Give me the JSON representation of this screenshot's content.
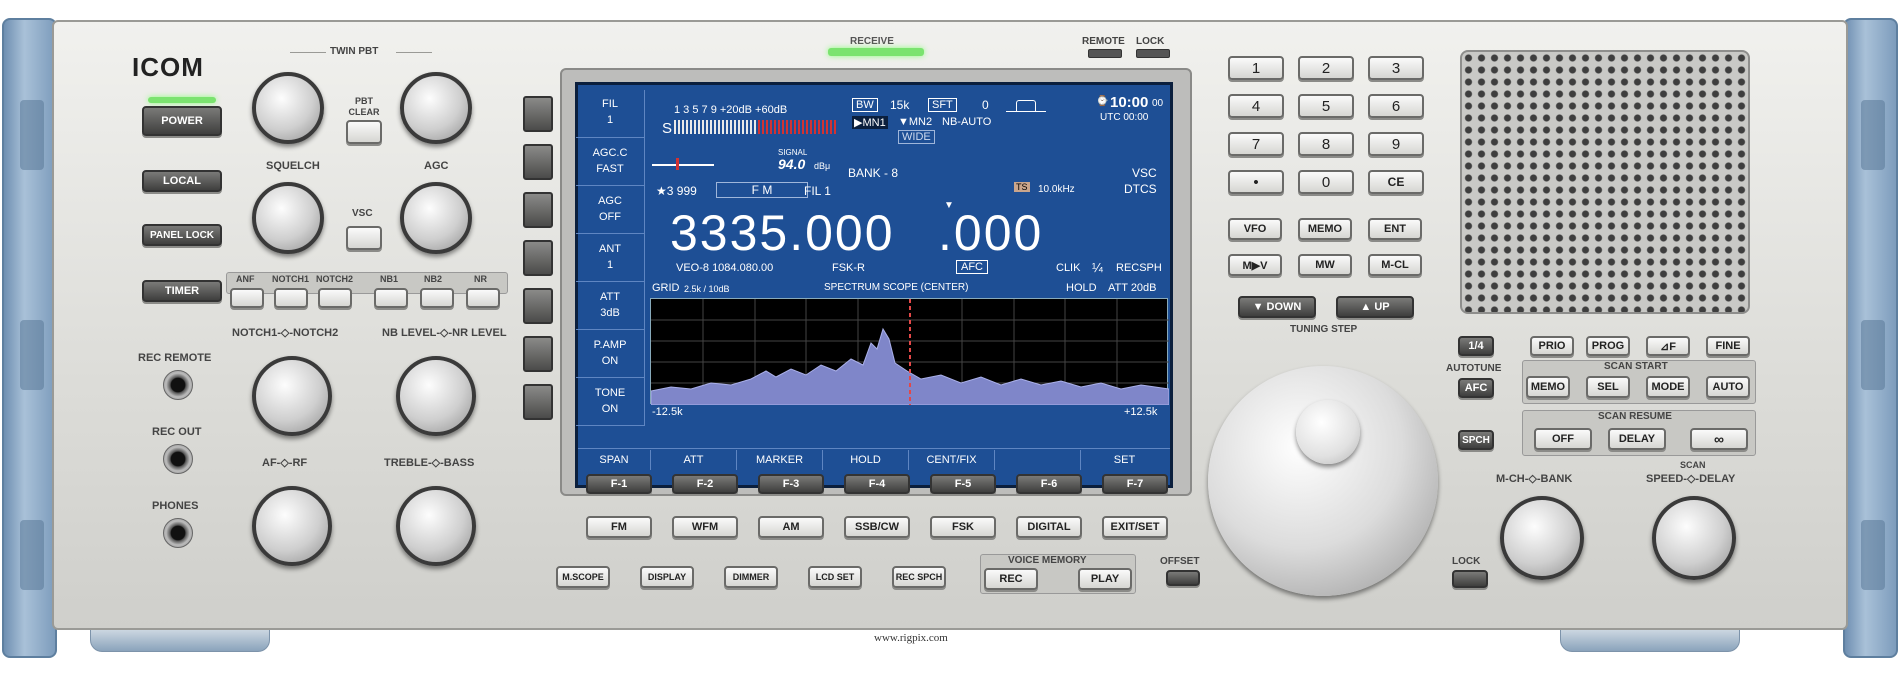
{
  "brand": "ICOM",
  "indicators": {
    "receive": "RECEIVE",
    "remote": "REMOTE",
    "lock": "LOCK"
  },
  "left_buttons": {
    "power": "POWER",
    "local": "LOCAL",
    "panel_lock": "PANEL LOCK",
    "timer": "TIMER"
  },
  "jacks": {
    "rec_remote": "REC REMOTE",
    "rec_out": "REC OUT",
    "phones": "PHONES"
  },
  "knob_labels": {
    "twin_pbt": "TWIN PBT",
    "pbt_clear": "PBT CLEAR",
    "squelch": "SQUELCH",
    "agc": "AGC",
    "vsc": "VSC",
    "notch": "NOTCH1-◇-NOTCH2",
    "nb_nr_level": "NB LEVEL-◇-NR LEVEL",
    "af_rf": "AF-◇-RF",
    "treble_bass": "TREBLE-◇-BASS"
  },
  "filter_buttons": [
    "ANF",
    "NOTCH1",
    "NOTCH2",
    "NB1",
    "NB2",
    "NR"
  ],
  "display": {
    "side_menu": [
      {
        "title": "FIL",
        "value": "1"
      },
      {
        "title": "AGC.C",
        "value": "FAST"
      },
      {
        "title": "AGC",
        "value": "OFF"
      },
      {
        "title": "ANT",
        "value": "1"
      },
      {
        "title": "ATT",
        "value": "3dB"
      },
      {
        "title": "P.AMP",
        "value": "ON"
      },
      {
        "title": "TONE",
        "value": "ON"
      }
    ],
    "meter_scale": "1  3  5  7  9  +20dB  +60dB",
    "meter_s": "S",
    "bw_label": "BW",
    "bw_value": "15k",
    "sft_label": "SFT",
    "sft_value": "0",
    "clock": "10:00",
    "clock_seconds": "00",
    "utc": "UTC 00:00",
    "mn1": "▶MN1",
    "mn2": "▼MN2",
    "nb_auto": "NB-AUTO",
    "wide": "WIDE",
    "signal_label": "SIGNAL",
    "signal_value": "94.0",
    "signal_unit": "dBμ",
    "bank": "BANK - 8",
    "vsc": "VSC",
    "dtcs": "DTCS",
    "memory": "★3  999",
    "mode": "F  M",
    "fil": "FIL 1",
    "ts_label": "TS",
    "ts_value": "10.0kHz",
    "frequency_main": "3335.000",
    "frequency_sub": ".000",
    "veo": "VEO-8  1084.080.00",
    "fsk": "FSK-R",
    "afc": "AFC",
    "clik": "CLIK",
    "quarter": "¼",
    "recsph": "RECSPH",
    "scope_grid": "GRID",
    "scope_grid_value": "2.5k / 10dB",
    "scope_title": "SPECTRUM SCOPE (CENTER)",
    "scope_hold": "HOLD",
    "scope_att": "ATT  20dB",
    "scope_left": "-12.5k",
    "scope_right": "+12.5k",
    "soft_keys": [
      "SPAN",
      "ATT",
      "MARKER",
      "HOLD",
      "CENT/FIX",
      "",
      "SET"
    ]
  },
  "f_keys": [
    "F-1",
    "F-2",
    "F-3",
    "F-4",
    "F-5",
    "F-6",
    "F-7"
  ],
  "mode_keys": [
    "FM",
    "WFM",
    "AM",
    "SSB/CW",
    "FSK",
    "DIGITAL",
    "EXIT/SET"
  ],
  "bottom_keys": [
    "M.SCOPE",
    "DISPLAY",
    "DIMMER",
    "LCD SET",
    "REC SPCH"
  ],
  "voice_memory": {
    "title": "VOICE MEMORY",
    "rec": "REC",
    "play": "PLAY"
  },
  "offset": "OFFSET",
  "keypad": [
    "1",
    "2",
    "3",
    "4",
    "5",
    "6",
    "7",
    "8",
    "9",
    "•",
    "0",
    "CE"
  ],
  "vfo_keys": [
    "VFO",
    "MEMO",
    "ENT",
    "M▶V",
    "MW",
    "M-CL"
  ],
  "down": "▼ DOWN",
  "up": "▲ UP",
  "tuning_step": "TUNING STEP",
  "autotune": {
    "quarter": "1/4",
    "label": "AUTOTUNE",
    "afc": "AFC",
    "spch": "SPCH",
    "lock": "LOCK"
  },
  "scan_row1": [
    "PRIO",
    "PROG",
    "⊿F",
    "FINE"
  ],
  "scan_start": "SCAN START",
  "scan_row2": [
    "MEMO",
    "SEL",
    "MODE",
    "AUTO"
  ],
  "scan_resume": "SCAN RESUME",
  "scan_row3": [
    "OFF",
    "DELAY",
    "∞"
  ],
  "mch_bank": "M-CH-◇-BANK",
  "scan": "SCAN",
  "speed_delay": "SPEED-◇-DELAY",
  "watermark": "www.rigpix.com"
}
